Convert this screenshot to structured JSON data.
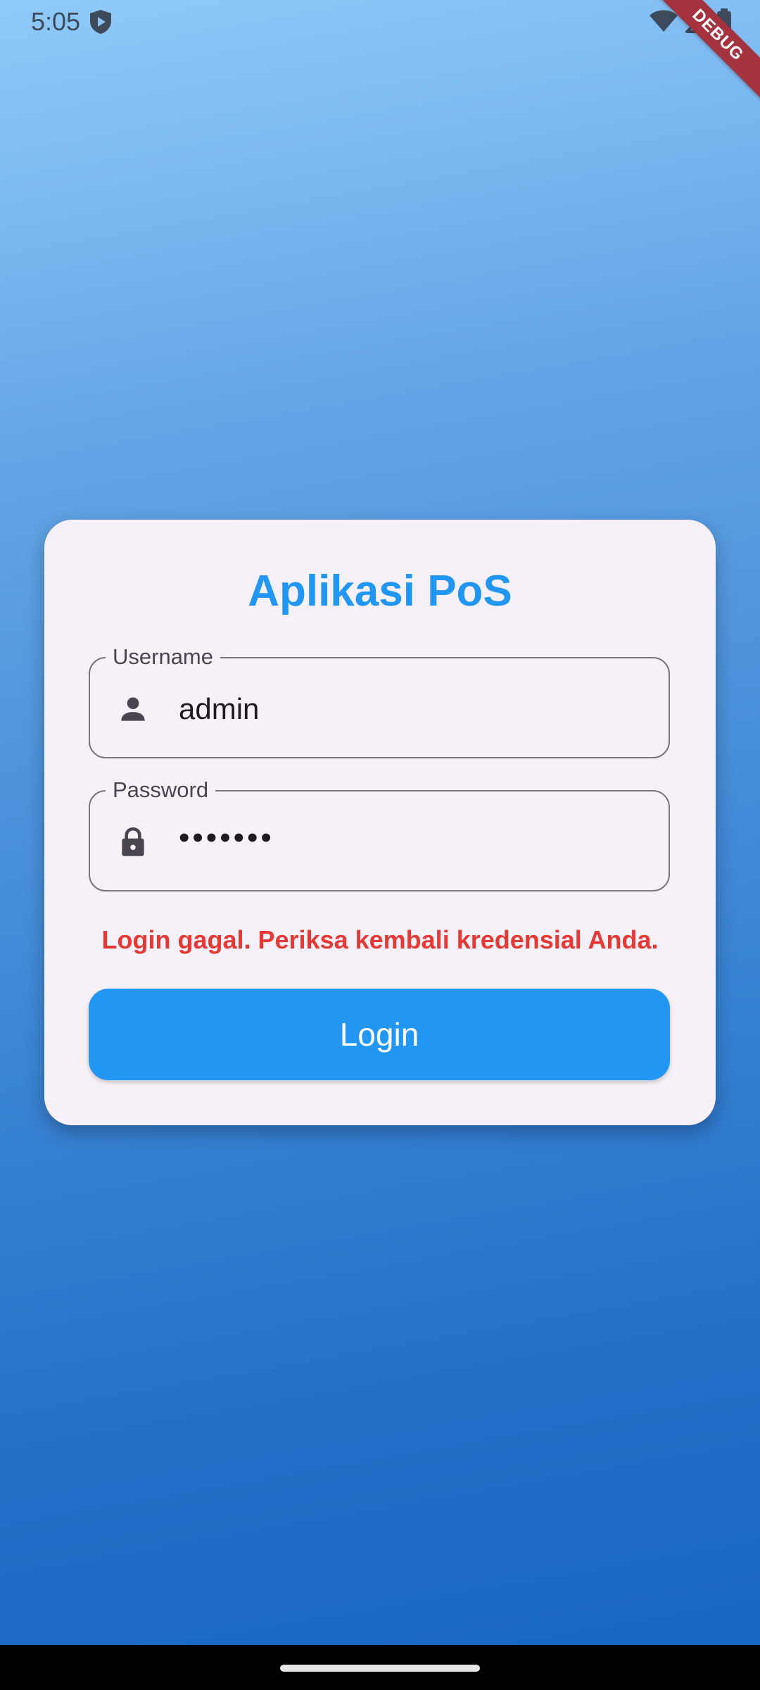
{
  "status_bar": {
    "time": "5:05",
    "icons": [
      "shield-play-icon",
      "wifi-icon",
      "cell-signal-icon",
      "battery-icon"
    ]
  },
  "debug_banner": {
    "label": "DEBUG",
    "color": "#a5333f"
  },
  "login_card": {
    "title": "Aplikasi PoS",
    "username": {
      "label": "Username",
      "value": "admin",
      "icon": "person-icon"
    },
    "password": {
      "label": "Password",
      "value": "•••••••",
      "icon": "lock-icon"
    },
    "error_message": "Login gagal. Periksa kembali kredensial Anda.",
    "login_button_label": "Login"
  },
  "colors": {
    "accent": "#2196f3",
    "error": "#e53935",
    "card_background": "#f6f1f8",
    "gradient_top": "#90caf9",
    "gradient_bottom": "#1565c0"
  }
}
